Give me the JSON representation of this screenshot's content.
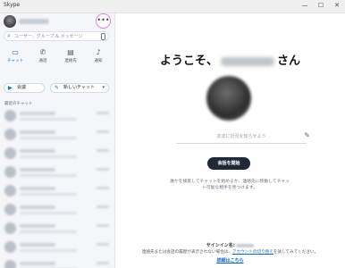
{
  "window": {
    "title": "Skype",
    "minimize": "—",
    "maximize": "☐",
    "close": "✕"
  },
  "sidebar": {
    "more_label": "•••",
    "search_placeholder": "ユーザー、グループ & メッセージ",
    "tabs": [
      {
        "label": "チャット",
        "icon": "chat-icon"
      },
      {
        "label": "通話",
        "icon": "phone-icon"
      },
      {
        "label": "連絡先",
        "icon": "contacts-icon"
      },
      {
        "label": "通知",
        "icon": "bell-icon"
      }
    ],
    "meet_label": "会議",
    "new_chat_label": "新しいチャット",
    "recent_label": "最近のチャット"
  },
  "main": {
    "welcome_prefix": "ようこそ、",
    "welcome_suffix": "さん",
    "mood_placeholder": "友達に近況を知らせよう",
    "start_button": "会話を開始",
    "hint_text": "誰かを検索してチャットを始めるか、連絡先に移動してチャット可能な相手を見つけます。",
    "signin_label": "サインイン名:",
    "note_prefix": "連絡先または会話の履歴が表示されない場合は、",
    "note_link": "アカウントの切り替え",
    "note_suffix": "を試してみてください。",
    "details_link": "詳細はこちら"
  },
  "colors": {
    "accent": "#0078d4",
    "start_button_bg": "#1f2937",
    "sidebar_bg": "#f4f6f9"
  }
}
